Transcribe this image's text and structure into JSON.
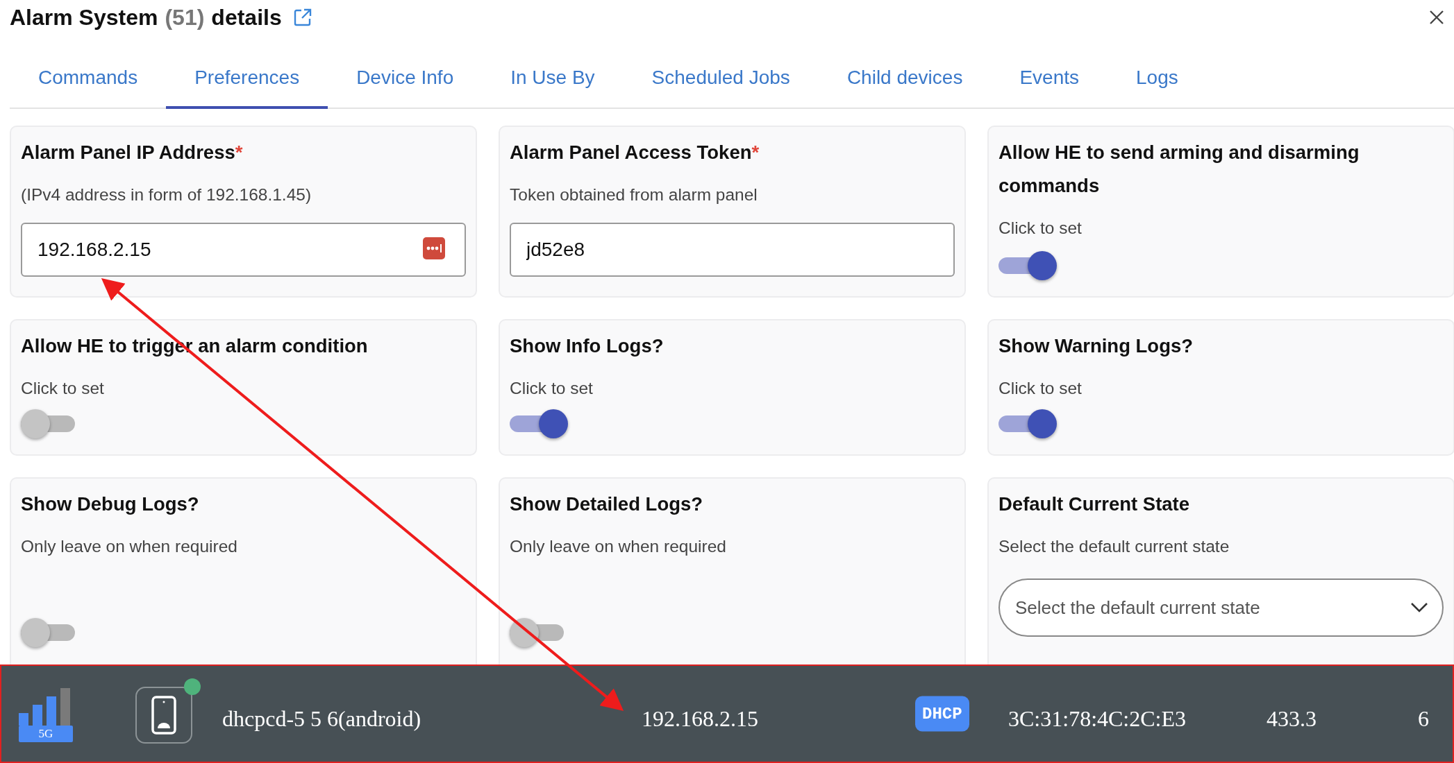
{
  "header": {
    "name": "Alarm System",
    "count": "(51)",
    "suffix": "details"
  },
  "tabs": [
    {
      "label": "Commands",
      "selected": false
    },
    {
      "label": "Preferences",
      "selected": true
    },
    {
      "label": "Device Info",
      "selected": false
    },
    {
      "label": "In Use By",
      "selected": false
    },
    {
      "label": "Scheduled Jobs",
      "selected": false
    },
    {
      "label": "Child devices",
      "selected": false
    },
    {
      "label": "Events",
      "selected": false
    },
    {
      "label": "Logs",
      "selected": false
    }
  ],
  "preferences": [
    {
      "kind": "text",
      "title": "Alarm Panel IP Address",
      "required_mark": "*",
      "description": "(IPv4 address in form of 192.168.1.45)",
      "value": "192.168.2.15",
      "password_manager": true
    },
    {
      "kind": "text",
      "title": "Alarm Panel Access Token",
      "required_mark": "*",
      "description": "Token obtained from alarm panel",
      "value": "jd52e8"
    },
    {
      "kind": "toggle",
      "title": "Allow HE to send arming and disarming commands",
      "description": "Click to set",
      "on": true
    },
    {
      "kind": "toggle",
      "title": "Allow HE to trigger an alarm condition",
      "description": "Click to set",
      "on": false
    },
    {
      "kind": "toggle",
      "title": "Show Info Logs?",
      "description": "Click to set",
      "on": true
    },
    {
      "kind": "toggle",
      "title": "Show Warning Logs?",
      "description": "Click to set",
      "on": true
    },
    {
      "kind": "toggle",
      "title": "Show Debug Logs?",
      "description": "Only leave on when required",
      "on": false
    },
    {
      "kind": "toggle",
      "title": "Show Detailed Logs?",
      "description": "Only leave on when required",
      "on": false
    },
    {
      "kind": "select",
      "title": "Default Current State",
      "description": "Select the default current state",
      "placeholder": "Select the default current state"
    }
  ],
  "device_bar": {
    "band": "5G",
    "online": true,
    "name": "dhcpcd-5 5 6(android)",
    "ip": "192.168.2.15",
    "badge": "DHCP",
    "mac": "3C:31:78:4C:2C:E3",
    "column_5": "433.3",
    "column_6": "6"
  },
  "annotation_arrow": true
}
